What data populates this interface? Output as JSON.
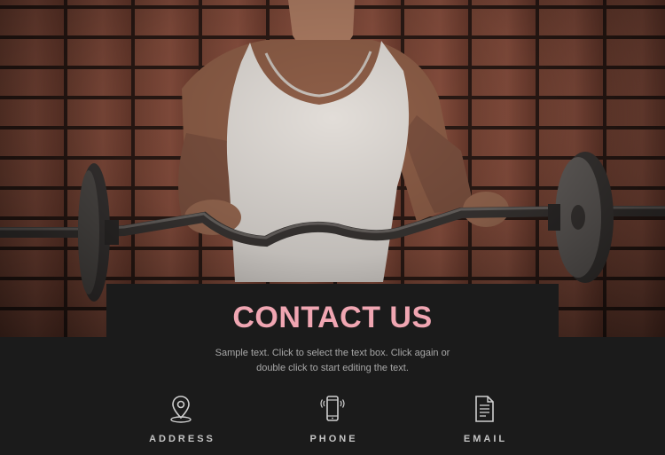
{
  "hero": {
    "image": "man-lifting-curl-barbell-photo"
  },
  "contact": {
    "title": "CONTACT US",
    "description_line1": "Sample text. Click to select the text box. Click again or",
    "description_line2": "double click to start editing the text."
  },
  "items": [
    {
      "label": "ADDRESS",
      "icon": "map-pin-icon"
    },
    {
      "label": "PHONE",
      "icon": "phone-icon"
    },
    {
      "label": "EMAIL",
      "icon": "document-icon"
    }
  ],
  "colors": {
    "title": "#f0a6b2",
    "background": "#1b1b1b",
    "text": "#a8a8a8",
    "label": "#c4c4c4"
  }
}
